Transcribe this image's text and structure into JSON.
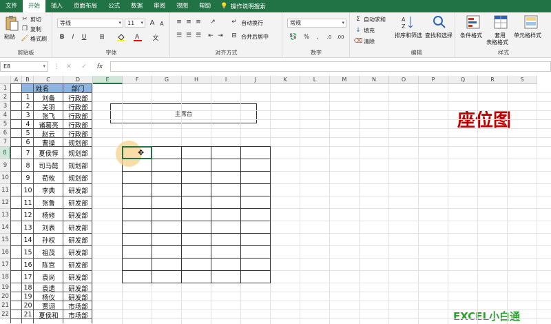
{
  "ribbon_tabs": [
    "文件",
    "开始",
    "插入",
    "页面布局",
    "公式",
    "数据",
    "审阅",
    "视图",
    "帮助"
  ],
  "active_tab": "开始",
  "tell_me": "操作说明搜索",
  "clipboard": {
    "paste": "粘贴",
    "cut": "剪切",
    "copy": "复制",
    "format_painter": "格式刷",
    "label": "剪贴板"
  },
  "font": {
    "name": "等线",
    "size": "11",
    "label": "字体",
    "bold": "B",
    "italic": "I",
    "underline": "U"
  },
  "alignment": {
    "wrap_text": "自动换行",
    "merge_center": "合并后居中",
    "label": "对齐方式"
  },
  "number": {
    "format": "常规",
    "percent": "%",
    "comma": ",",
    "label": "数字"
  },
  "editing": {
    "autosum": "自动求和",
    "fill": "填充",
    "clear": "清除",
    "sort_filter": "排序和筛选",
    "find_select": "查找和选择",
    "label": "编辑"
  },
  "styles": {
    "conditional": "条件格式",
    "table_format_1": "套用",
    "table_format_2": "表格格式",
    "cell_styles": "单元格样式",
    "label": "样式"
  },
  "name_box": "E8",
  "fx": "fx",
  "columns": [
    "A",
    "B",
    "C",
    "D",
    "E",
    "F",
    "G",
    "H",
    "I",
    "J",
    "K",
    "L",
    "M",
    "N",
    "O",
    "P",
    "Q",
    "R",
    "S"
  ],
  "rows": [
    "1",
    "2",
    "3",
    "4",
    "5",
    "6",
    "7",
    "8",
    "9",
    "10",
    "11",
    "12",
    "13",
    "14",
    "15",
    "16",
    "17",
    "18",
    "19",
    "20",
    "21",
    "22"
  ],
  "table_header": {
    "name": "姓名",
    "dept": "部门"
  },
  "employees": [
    {
      "no": "1",
      "name": "刘备",
      "dept": "行政部"
    },
    {
      "no": "2",
      "name": "关羽",
      "dept": "行政部"
    },
    {
      "no": "3",
      "name": "张飞",
      "dept": "行政部"
    },
    {
      "no": "4",
      "name": "诸葛亮",
      "dept": "行政部"
    },
    {
      "no": "5",
      "name": "赵云",
      "dept": "行政部"
    },
    {
      "no": "6",
      "name": "曹操",
      "dept": "规划部"
    },
    {
      "no": "7",
      "name": "夏侯惇",
      "dept": "规划部"
    },
    {
      "no": "8",
      "name": "司马懿",
      "dept": "规划部"
    },
    {
      "no": "9",
      "name": "荀攸",
      "dept": "规划部"
    },
    {
      "no": "10",
      "name": "李典",
      "dept": "研发部"
    },
    {
      "no": "11",
      "name": "张鲁",
      "dept": "研发部"
    },
    {
      "no": "12",
      "name": "杨修",
      "dept": "研发部"
    },
    {
      "no": "13",
      "name": "刘表",
      "dept": "研发部"
    },
    {
      "no": "14",
      "name": "孙权",
      "dept": "研发部"
    },
    {
      "no": "15",
      "name": "祖茂",
      "dept": "研发部"
    },
    {
      "no": "16",
      "name": "陈宫",
      "dept": "研发部"
    },
    {
      "no": "17",
      "name": "袁尚",
      "dept": "研发部"
    },
    {
      "no": "18",
      "name": "袁遗",
      "dept": "研发部"
    },
    {
      "no": "19",
      "name": "杨仪",
      "dept": "研发部"
    },
    {
      "no": "20",
      "name": "贾诩",
      "dept": "市场部"
    },
    {
      "no": "21",
      "name": "夏侯和",
      "dept": "市场部"
    }
  ],
  "podium_label": "主席台",
  "seat_title": "座位图",
  "watermark": "EXCEL小白通",
  "colors": {
    "excel_green": "#217346",
    "header_blue": "#8db4e2",
    "title_red": "#c00000",
    "watermark_green": "#2aa02a"
  }
}
